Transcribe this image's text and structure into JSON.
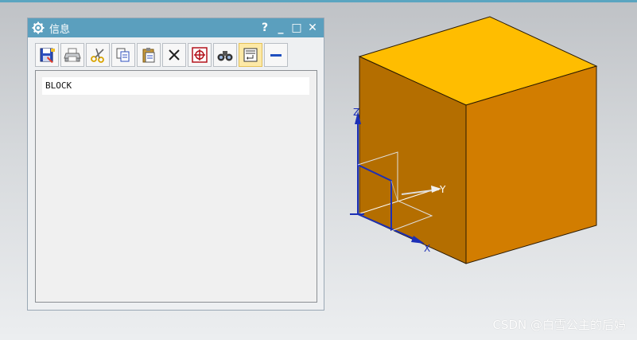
{
  "window": {
    "title": "信息",
    "help_label": "?",
    "minimize_label": "_",
    "maximize_label": "□",
    "close_label": "✕"
  },
  "toolbar": {
    "buttons": [
      {
        "name": "save-button",
        "icon": "save-icon"
      },
      {
        "name": "print-button",
        "icon": "printer-icon"
      },
      {
        "name": "cut-button",
        "icon": "scissors-icon"
      },
      {
        "name": "copy-button",
        "icon": "copy-icon"
      },
      {
        "name": "paste-button",
        "icon": "paste-icon"
      },
      {
        "name": "delete-button",
        "icon": "x-icon"
      },
      {
        "name": "target-button",
        "icon": "crosshair-icon"
      },
      {
        "name": "find-button",
        "icon": "binoculars-icon"
      },
      {
        "name": "wrap-button",
        "icon": "wrap-icon",
        "active": true
      },
      {
        "name": "collapse-button",
        "icon": "minus-icon"
      }
    ]
  },
  "content": {
    "lines": [
      "BLOCK"
    ]
  },
  "axes": {
    "x": "X",
    "y": "Y",
    "z": "Z"
  },
  "watermark": "CSDN @白雪公主的后妈",
  "colors": {
    "titlebar": "#5b9fbe",
    "block_top": "#ffbd00",
    "block_right": "#d27d00",
    "block_left": "#b46e00",
    "axis_blue": "#1c2fb6"
  }
}
